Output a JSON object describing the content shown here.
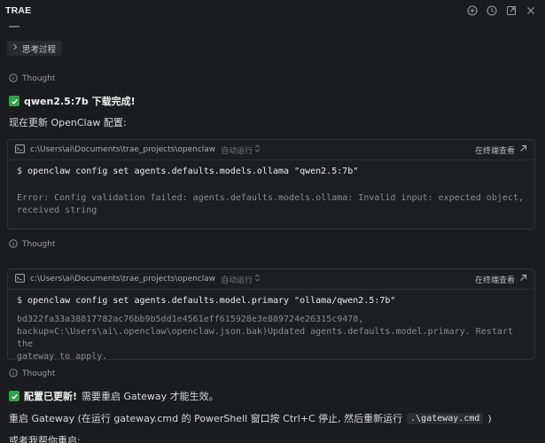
{
  "app": {
    "title": "TRAE"
  },
  "top_icons": [
    "add-chat-icon",
    "history-icon",
    "external-window-icon",
    "close-icon"
  ],
  "thinking_pill": {
    "label": "思考过程"
  },
  "thoughts": [
    "Thought",
    "Thought",
    "Thought"
  ],
  "msg1": {
    "bold": "qwen2.5:7b 下载完成!"
  },
  "msg2": {
    "text": "现在更新 OpenClaw 配置:"
  },
  "term1": {
    "path": "c:\\Users\\ai\\Documents\\trae_projects\\openclaw",
    "auto": "自动运行",
    "open": "在终端查看",
    "command": "openclaw config set agents.defaults.models.ollama \"qwen2.5:7b\"",
    "output": "Error: Config validation failed: agents.defaults.models.ollama: Invalid input: expected object,\nreceived string"
  },
  "term2": {
    "path": "c:\\Users\\ai\\Documents\\trae_projects\\openclaw",
    "auto": "自动运行",
    "open": "在终端查看",
    "command": "openclaw config set agents.defaults.model.primary \"ollama/qwen2.5:7b\"",
    "output": "bd322fa33a38817782ac76bb9b5dd1e4561eff615928e3e889724e26315c9478,\nbackup=C:\\Users\\ai\\.openclaw\\openclaw.json.bak)Updated agents.defaults.model.primary. Restart the\ngateway to apply."
  },
  "msg3": {
    "bold": "配置已更新!",
    "rest": "需要重启 Gateway 才能生效。"
  },
  "msg4": {
    "text": "重启 Gateway (在运行 gateway.cmd 的 PowerShell 窗口按 Ctrl+C 停止, 然后重新运行",
    "code": ".\\gateway.cmd",
    "end": ")"
  },
  "msg5": {
    "text": "或者我帮你重启:"
  },
  "colors": {
    "background": "#1b1c1f",
    "check": "#2fa34a",
    "border": "#303236"
  }
}
